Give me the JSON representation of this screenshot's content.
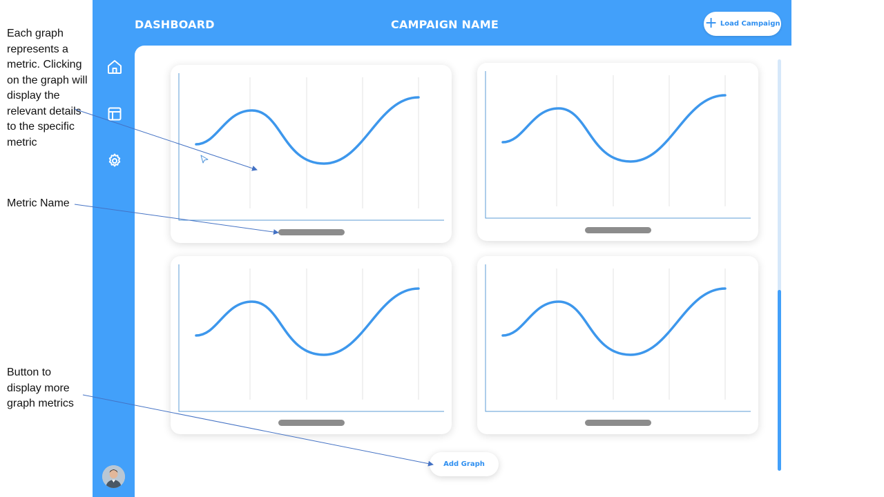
{
  "annotations": {
    "graph_note": "Each graph represents a metric. Clicking on the graph will display the relevant details to the specific metric",
    "metric_note": "Metric Name",
    "button_note": "Button to display more graph metrics"
  },
  "header": {
    "left_title": "DASHBOARD",
    "center_title": "CAMPAIGN NAME",
    "load_button_label": "Load Campaign"
  },
  "sidebar": {
    "items": [
      {
        "icon": "home-icon"
      },
      {
        "icon": "layout-icon"
      },
      {
        "icon": "gear-icon"
      }
    ],
    "avatar": "user-avatar"
  },
  "graphs": {
    "count": 4,
    "curve_color": "#3d97ec",
    "axis_color": "#5b9bd5",
    "metric_name_placeholder_color": "#8c8c8c"
  },
  "add_button_label": "Add Graph",
  "colors": {
    "accent": "#42a0fa",
    "button_text": "#2f8ff0"
  }
}
